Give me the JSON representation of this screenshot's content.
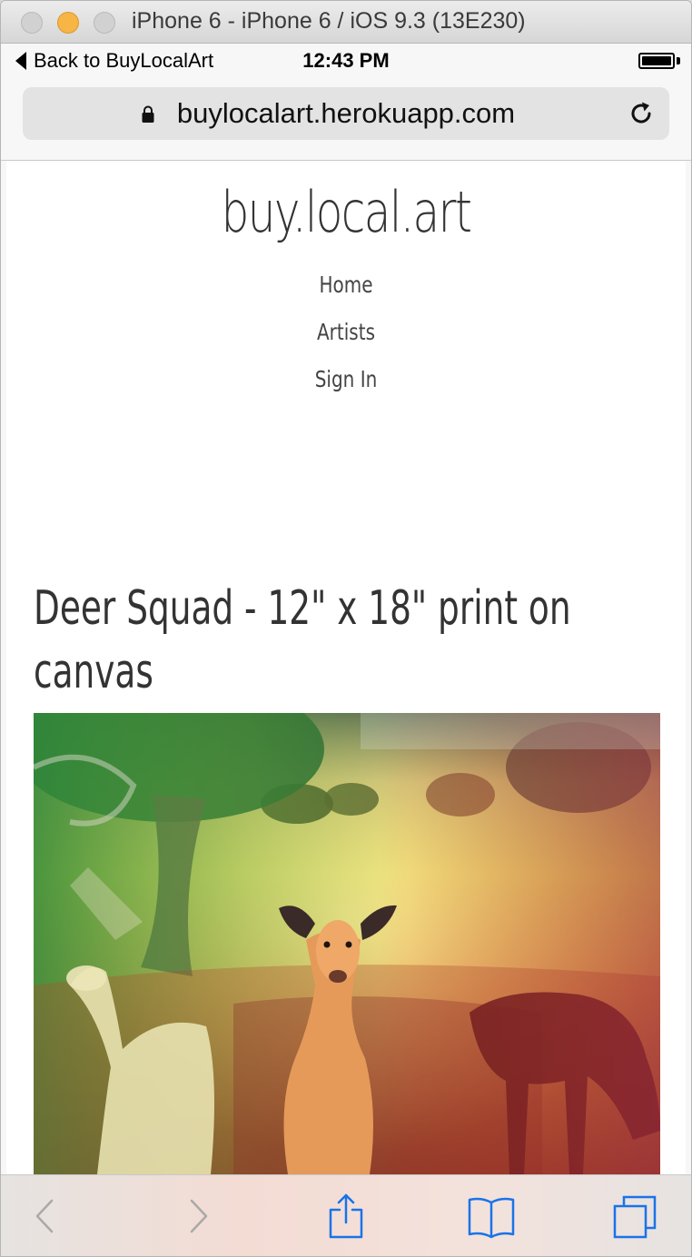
{
  "simulator": {
    "window_title": "iPhone 6 - iPhone 6 / iOS 9.3 (13E230)"
  },
  "status_bar": {
    "back_label": "Back to BuyLocalArt",
    "time": "12:43 PM",
    "battery_level": 1.0
  },
  "browser": {
    "url": "buylocalart.herokuapp.com",
    "secure": true
  },
  "page": {
    "site_title": "buy.local.art",
    "nav": {
      "home": "Home",
      "artists": "Artists",
      "sign_in": "Sign In"
    },
    "artwork": {
      "title": "Deer Squad - 12\" x 18\" print on canvas"
    }
  },
  "toolbar": {
    "icons": [
      "back-icon",
      "forward-icon",
      "share-icon",
      "bookmarks-icon",
      "tabs-icon"
    ],
    "accent_color": "#1a73e8",
    "disabled_color": "#a9a9a9"
  }
}
